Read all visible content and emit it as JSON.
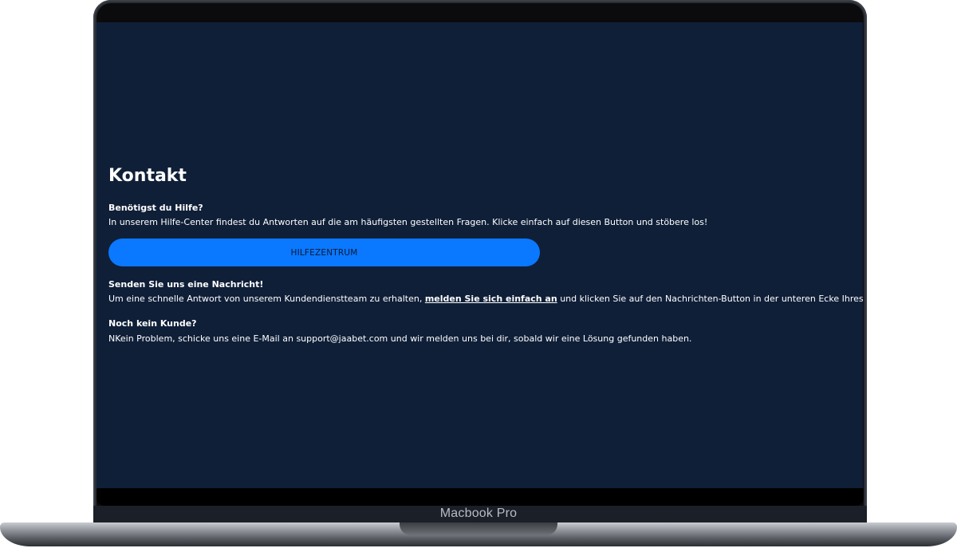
{
  "device": {
    "model_label": "Macbook Pro"
  },
  "page": {
    "title": "Kontakt"
  },
  "help": {
    "heading": "Benötigst du Hilfe?",
    "text": "In unserem Hilfe-Center findest du Antworten auf die am häufigsten gestellten Fragen. Klicke einfach auf diesen Button und stöbere los!",
    "button_label": "HILFEZENTRUM"
  },
  "message": {
    "heading": "Senden Sie uns eine Nachricht!",
    "text_before": "Um eine schnelle Antwort von unserem Kundendienstteam zu erhalten, ",
    "link_label": "melden Sie sich einfach an",
    "text_after": " und klicken Sie auf den Nachrichten-Button in der unteren Ecke Ihres Bildschirms ",
    "emoji_icon": "smiling-face-icon"
  },
  "no_customer": {
    "heading": "Noch kein Kunde?",
    "text": "NKein Problem, schicke uns eine E-Mail an support@jaabet.com und wir melden uns bei dir, sobald wir eine Lösung gefunden haben."
  },
  "colors": {
    "screen_background": "#0f1f38",
    "button_background": "#0a78ff",
    "text": "#ffffff"
  }
}
